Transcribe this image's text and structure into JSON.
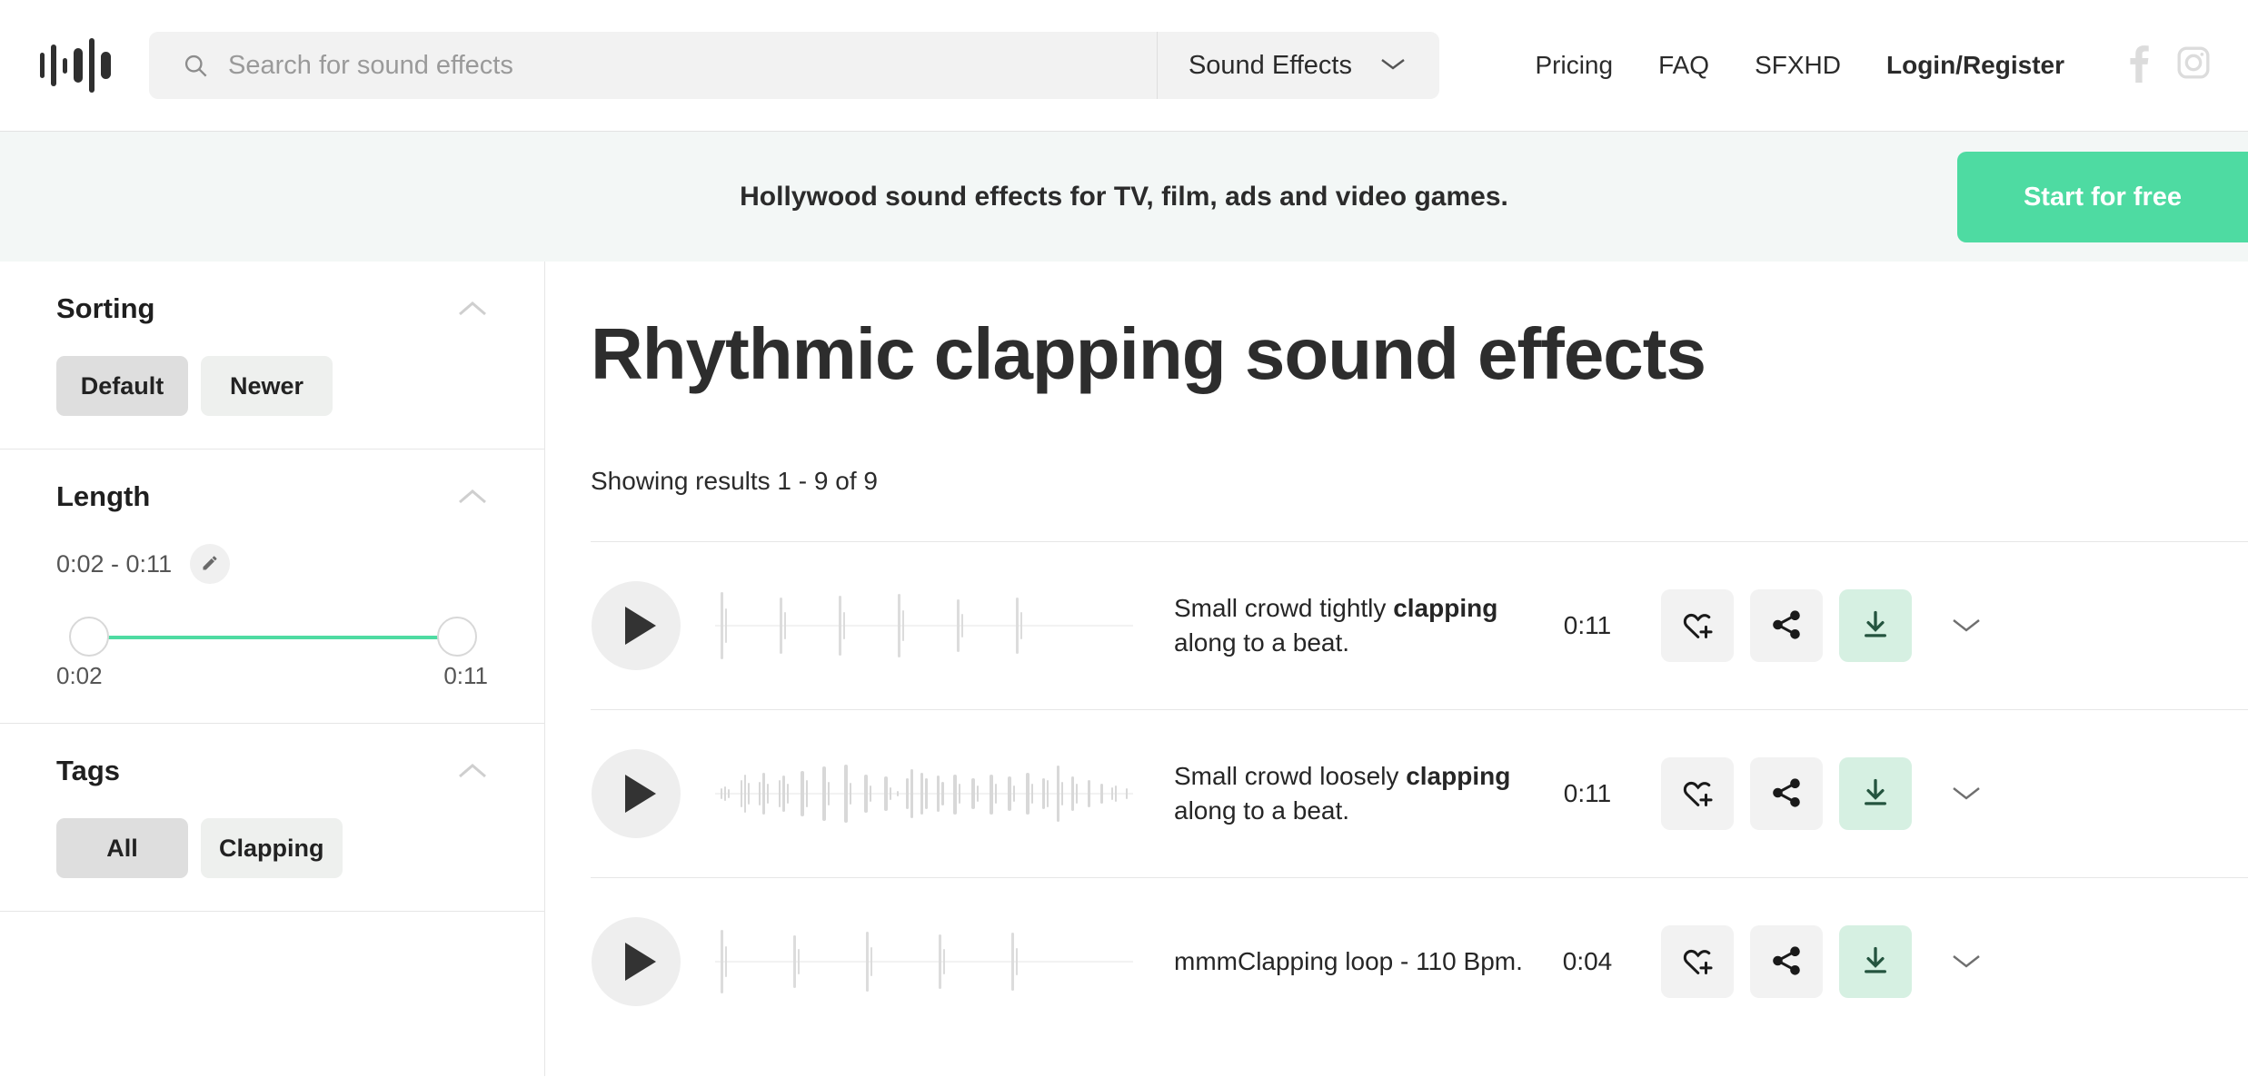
{
  "header": {
    "logo_name": "soundsnap-waveform-logo",
    "search": {
      "placeholder": "Search for sound effects",
      "value": ""
    },
    "category": {
      "selected": "Sound Effects"
    },
    "nav": [
      {
        "label": "Pricing",
        "bold": false
      },
      {
        "label": "FAQ",
        "bold": false
      },
      {
        "label": "SFXHD",
        "bold": false
      },
      {
        "label": "Login/Register",
        "bold": true
      }
    ],
    "social": [
      "facebook-icon",
      "instagram-icon"
    ]
  },
  "banner": {
    "text": "Hollywood sound effects for TV, film, ads and video games.",
    "cta_label": "Start for free",
    "cta_color": "#4edba2",
    "background": "#f3f7f6"
  },
  "sidebar": {
    "sorting": {
      "title": "Sorting",
      "options": [
        {
          "label": "Default",
          "active": true
        },
        {
          "label": "Newer",
          "active": false
        }
      ]
    },
    "length": {
      "title": "Length",
      "range_label": "0:02 - 0:11",
      "min_label": "0:02",
      "max_label": "0:11",
      "track_color": "#4edba2"
    },
    "tags": {
      "title": "Tags",
      "options": [
        {
          "label": "All",
          "active": true
        },
        {
          "label": "Clapping",
          "active": false
        }
      ]
    }
  },
  "main": {
    "page_title": "Rhythmic clapping sound effects",
    "results_count": "Showing results 1 - 9 of 9",
    "results": [
      {
        "title_prefix": "Small crowd tightly ",
        "title_highlight": "clapping",
        "title_suffix": " along to a beat.",
        "duration": "0:11",
        "waveform": "sparse-claps"
      },
      {
        "title_prefix": "Small crowd loosely ",
        "title_highlight": "clapping",
        "title_suffix": " along to a beat.",
        "duration": "0:11",
        "waveform": "dense-claps"
      },
      {
        "title_prefix": "mmmClapping loop - 110 Bpm.",
        "title_highlight": "",
        "title_suffix": "",
        "duration": "0:04",
        "waveform": "sparse-claps"
      }
    ],
    "row_actions": {
      "favorite": "heart-plus-icon",
      "share": "share-icon",
      "download": "download-icon",
      "expand": "chevron-down-icon"
    }
  }
}
